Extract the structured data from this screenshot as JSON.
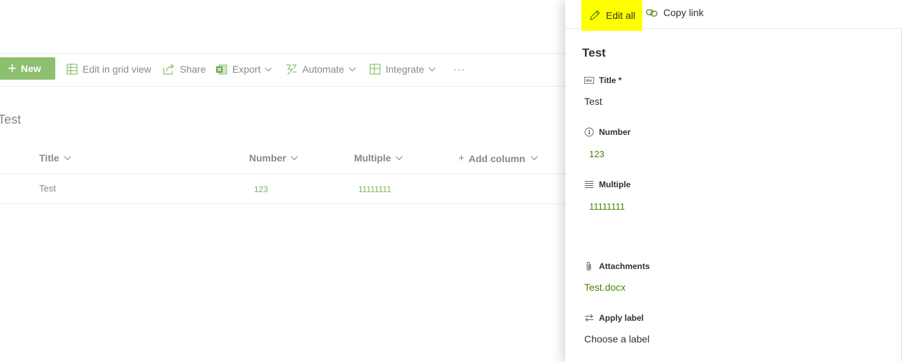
{
  "toolbar": {
    "new_label": "New",
    "edit_grid_label": "Edit in grid view",
    "share_label": "Share",
    "export_label": "Export",
    "automate_label": "Automate",
    "integrate_label": "Integrate",
    "more_label": "···"
  },
  "list": {
    "title": "Test",
    "columns": [
      "Title",
      "Number",
      "Multiple",
      "Add column"
    ],
    "rows": [
      {
        "title": "Test",
        "number": "123",
        "multiple": "11111111"
      }
    ]
  },
  "panel": {
    "edit_all_label": "Edit all",
    "copy_link_label": "Copy link",
    "item_title": "Test",
    "fields": [
      {
        "label": "Title *",
        "value": "Test",
        "icon": "text-field-icon"
      },
      {
        "label": "Number",
        "value": "123",
        "icon": "number-circle-icon"
      },
      {
        "label": "Multiple",
        "value": "11111111",
        "icon": "multiline-text-icon"
      },
      {
        "label": "Attachments",
        "value": "Test.docx",
        "icon": "paperclip-icon"
      },
      {
        "label": "Apply label",
        "value": "Choose a label",
        "icon": "swap-arrows-icon"
      }
    ]
  },
  "colors": {
    "accent_green": "#8cbf6f",
    "value_green": "#498205",
    "highlight": "#ffff00"
  }
}
